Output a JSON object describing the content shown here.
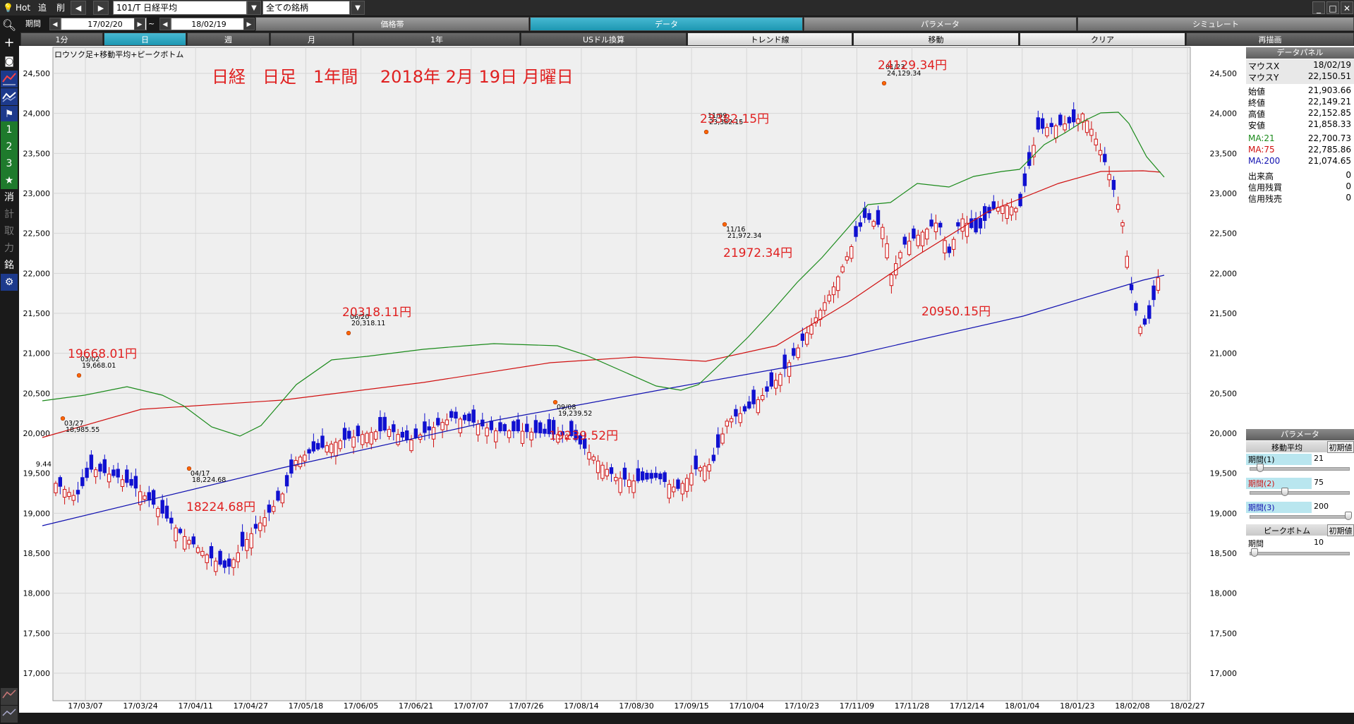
{
  "toolbar": {
    "hot_label": "Hot",
    "add_label": "追",
    "del_label": "削",
    "symbol": "101/T 日経平均",
    "group": "全ての銘柄",
    "period_label": "期間",
    "date_from": "17/02/20",
    "date_sep": "~",
    "date_to": "18/02/19",
    "tabs": [
      "価格帯",
      "データ",
      "パラメータ",
      "シミュレート"
    ],
    "selected_tab": "データ",
    "row3": [
      "1分",
      "日",
      "週",
      "月",
      "1年",
      "USドル換算",
      "トレンド線",
      "移動",
      "クリア",
      "再描画"
    ],
    "row3_selected": "日"
  },
  "leftbar": {
    "items": [
      "search-icon",
      "plus-icon",
      "camera-icon",
      "line-chart-icon",
      "indicator-icon",
      "flag-icon",
      "1",
      "2",
      "3",
      "star-icon",
      "消",
      "計",
      "取",
      "力",
      "銘",
      "gear-icon"
    ]
  },
  "chart": {
    "subtitle": "ロウソク足+移動平均+ピークボトム",
    "heading": "日経　日足　1年間　 2018年 2月 19日 月曜日",
    "y_ticks": [
      "24,500",
      "24,000",
      "23,500",
      "23,000",
      "22,500",
      "22,000",
      "21,500",
      "21,000",
      "20,500",
      "20,000",
      "19,500",
      "19,000",
      "18,500",
      "18,000",
      "17,500",
      "17,000"
    ],
    "x_ticks": [
      "17/03/07",
      "17/03/24",
      "17/04/11",
      "17/04/27",
      "17/05/18",
      "17/06/05",
      "17/06/21",
      "17/07/07",
      "17/07/26",
      "17/08/14",
      "17/08/30",
      "17/09/15",
      "17/10/04",
      "17/10/23",
      "17/11/09",
      "17/11/28",
      "17/12/14",
      "18/01/04",
      "18/01/23",
      "18/02/08",
      "18/02/27"
    ],
    "big_labels": [
      "19668.01円",
      "18224.68円",
      "20318.11円",
      "19239.52円",
      "23382.15円",
      "21972.34円",
      "24129.34円",
      "20950.15円"
    ],
    "peak_labels": [
      {
        "date": "03/02",
        "value": "19,668.01"
      },
      {
        "date": "03/27",
        "value": "18,985.55"
      },
      {
        "date": "04/17",
        "value": "18,224.68"
      },
      {
        "date": "06/20",
        "value": "20,318.11"
      },
      {
        "date": "09/08",
        "value": "19,239.52"
      },
      {
        "date": "11/09",
        "value": "23,382.15"
      },
      {
        "date": "11/16",
        "value": "21,972.34"
      },
      {
        "date": "01/23",
        "value": "24,129.34"
      }
    ],
    "edge_label": "9.44"
  },
  "panel": {
    "title": "データパネル",
    "rows": [
      {
        "k": "マウスX",
        "v": "18/02/19"
      },
      {
        "k": "マウスY",
        "v": "22,150.51"
      },
      {
        "k": "始値",
        "v": "21,903.66"
      },
      {
        "k": "終値",
        "v": "22,149.21"
      },
      {
        "k": "高値",
        "v": "22,152.85"
      },
      {
        "k": "安値",
        "v": "21,858.33"
      },
      {
        "k": "MA:21",
        "v": "22,700.73"
      },
      {
        "k": "MA:75",
        "v": "22,785.86"
      },
      {
        "k": "MA:200",
        "v": "21,074.65"
      },
      {
        "k": "出来高",
        "v": "0"
      },
      {
        "k": "信用残買",
        "v": "0"
      },
      {
        "k": "信用残売",
        "v": "0"
      }
    ],
    "param_title": "パラメータ",
    "ma_title": "移動平均",
    "init_label": "初期値",
    "p1_label": "期間(1)",
    "p1_value": "21",
    "p2_label": "期間(2)",
    "p2_value": "75",
    "p3_label": "期間(3)",
    "p3_value": "200",
    "pb_title": "ピークボトム",
    "pb_label": "期間",
    "pb_value": "10"
  },
  "colors": {
    "ma21": "#1a8a1a",
    "ma75": "#d01010",
    "ma200": "#1010b0",
    "up": "#d01010",
    "down": "#1010d0",
    "accent": "#1d97b2"
  }
}
